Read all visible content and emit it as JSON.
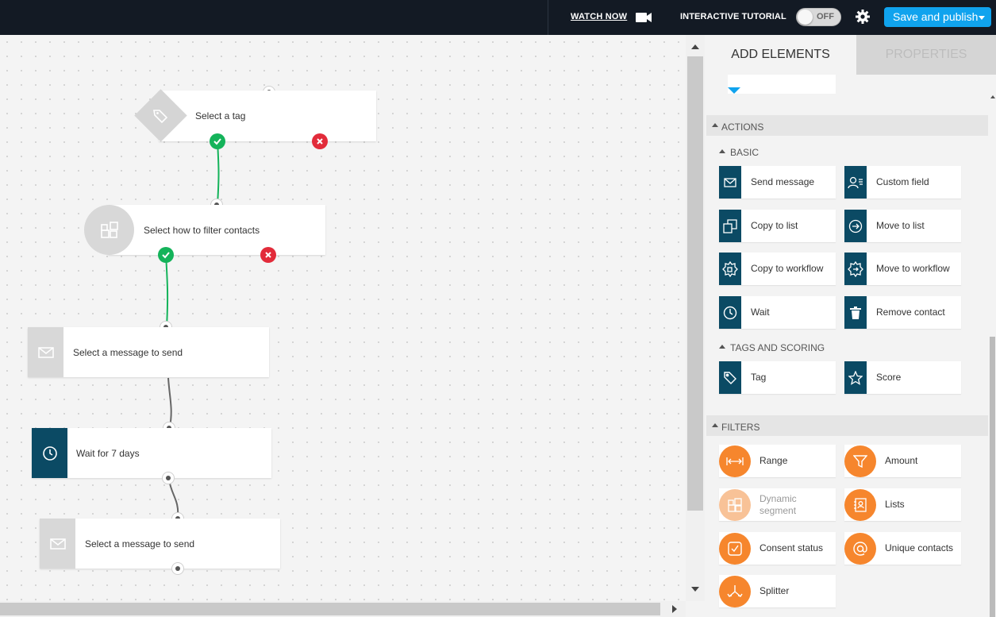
{
  "topbar": {
    "watch_now": "WATCH NOW",
    "tutorial_label": "INTERACTIVE TUTORIAL",
    "toggle_state": "OFF",
    "publish_label": "Save and publish"
  },
  "canvas": {
    "nodes": {
      "tag": "Select a tag",
      "filter": "Select how to filter contacts",
      "message1": "Select a message to send",
      "wait": "Wait for 7 days",
      "message2": "Select a message to send"
    }
  },
  "panel": {
    "tabs": {
      "add": "ADD ELEMENTS",
      "properties": "PROPERTIES"
    },
    "actions": {
      "title": "ACTIONS",
      "basic": {
        "title": "BASIC",
        "items": [
          "Send message",
          "Custom field",
          "Copy to list",
          "Move to list",
          "Copy to workflow",
          "Move to workflow",
          "Wait",
          "Remove contact"
        ]
      },
      "tags_scoring": {
        "title": "TAGS AND SCORING",
        "items": [
          "Tag",
          "Score"
        ]
      }
    },
    "filters": {
      "title": "FILTERS",
      "items": [
        "Range",
        "Amount",
        "Dynamic segment",
        "Lists",
        "Consent status",
        "Unique contacts",
        "Splitter"
      ]
    }
  },
  "colors": {
    "topbar": "#131a24",
    "publish": "#10a3ee",
    "action_icon": "#0b4a64",
    "filter_icon": "#f6862d",
    "success": "#14b35a",
    "fail": "#e22b3a"
  }
}
